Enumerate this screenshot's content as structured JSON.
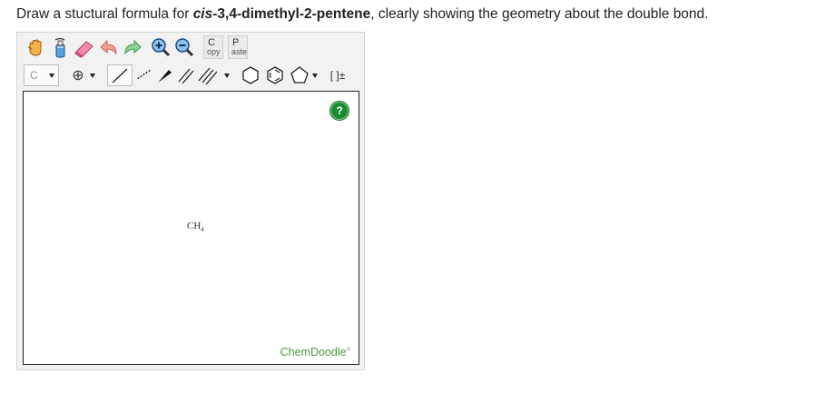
{
  "question": {
    "prefix": "Draw a stuctural formula for ",
    "cis": "cis",
    "compound": "-3,4-dimethyl-2-pentene",
    "suffix": ", clearly showing the geometry about the double bond."
  },
  "toolbar": {
    "copy": {
      "big": "C",
      "small": "opy"
    },
    "paste": {
      "big": "P",
      "small": "aste"
    },
    "element_label": "C",
    "charge_symbol": "⊕",
    "bracket_label": "[ ]±"
  },
  "canvas": {
    "atom_main": "CH",
    "atom_sub": "4",
    "help_label": "?",
    "brand": "ChemDoodle",
    "brand_mark": "®"
  },
  "icons": [
    "hand-icon",
    "lasso-bottle-icon",
    "eraser-icon",
    "undo-icon",
    "redo-icon",
    "zoom-in-icon",
    "zoom-out-icon",
    "single-bond-icon",
    "dashed-bond-icon",
    "wedge-bond-icon",
    "double-bond-icon",
    "triple-bond-icon",
    "cyclohexane-icon",
    "benzene-icon",
    "cyclopentane-icon"
  ],
  "colors": {
    "accent_green": "#178c2e",
    "brand_green": "#4a9a3a",
    "toolbar_bg": "#f2f2f2"
  }
}
